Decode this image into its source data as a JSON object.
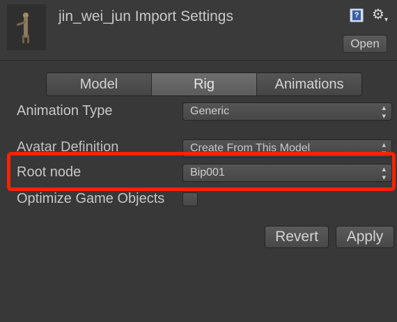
{
  "header": {
    "title": "jin_wei_jun Import Settings",
    "help_icon": "help-book-icon",
    "gear_icon": "gear-icon",
    "open_label": "Open"
  },
  "tabs": [
    {
      "label": "Model",
      "active": false
    },
    {
      "label": "Rig",
      "active": true
    },
    {
      "label": "Animations",
      "active": false
    }
  ],
  "fields": {
    "animation_type": {
      "label": "Animation Type",
      "value": "Generic"
    },
    "avatar_definition": {
      "label": "Avatar Definition",
      "value": "Create From This Model"
    },
    "root_node": {
      "label": "Root node",
      "value": "Bip001"
    },
    "optimize": {
      "label": "Optimize Game Objects",
      "checked": false
    }
  },
  "buttons": {
    "revert": "Revert",
    "apply": "Apply"
  },
  "highlight_color": "#ff2200"
}
